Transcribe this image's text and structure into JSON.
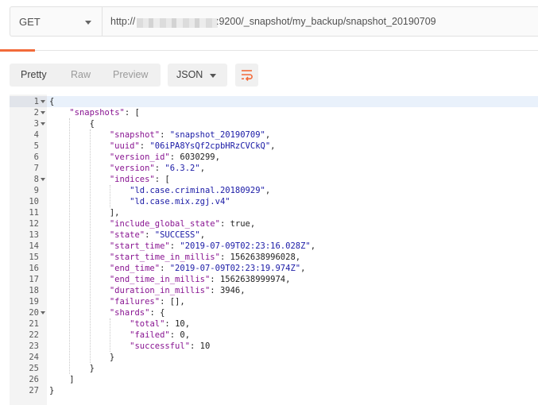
{
  "request": {
    "method": "GET",
    "url_prefix": "http://",
    "url_rest": ":9200/_snapshot/my_backup/snapshot_20190709"
  },
  "response_toolbar": {
    "view_modes": [
      "Pretty",
      "Raw",
      "Preview"
    ],
    "active_view": "Pretty",
    "format": "JSON",
    "wrap_icon": "wrap-lines-icon"
  },
  "colors": {
    "accent": "#f26b3a",
    "json_key": "#881391",
    "json_string": "#1a1aa6",
    "active_line": "#e9f1fb"
  },
  "code_lines": [
    {
      "n": "1",
      "fold": true,
      "active": true,
      "t": [
        [
          "p",
          "{"
        ]
      ]
    },
    {
      "n": "2",
      "fold": true,
      "t": [
        [
          "p",
          "    "
        ],
        [
          "k",
          "\"snapshots\""
        ],
        [
          "p",
          ": ["
        ]
      ]
    },
    {
      "n": "3",
      "fold": true,
      "t": [
        [
          "p",
          "        {"
        ]
      ]
    },
    {
      "n": "4",
      "t": [
        [
          "p",
          "            "
        ],
        [
          "k",
          "\"snapshot\""
        ],
        [
          "p",
          ": "
        ],
        [
          "s",
          "\"snapshot_20190709\""
        ],
        [
          "p",
          ","
        ]
      ]
    },
    {
      "n": "5",
      "t": [
        [
          "p",
          "            "
        ],
        [
          "k",
          "\"uuid\""
        ],
        [
          "p",
          ": "
        ],
        [
          "s",
          "\"06iPA8YsQf2cpbHRzCVCkQ\""
        ],
        [
          "p",
          ","
        ]
      ]
    },
    {
      "n": "6",
      "t": [
        [
          "p",
          "            "
        ],
        [
          "k",
          "\"version_id\""
        ],
        [
          "p",
          ": "
        ],
        [
          "n",
          "6030299"
        ],
        [
          "p",
          ","
        ]
      ]
    },
    {
      "n": "7",
      "t": [
        [
          "p",
          "            "
        ],
        [
          "k",
          "\"version\""
        ],
        [
          "p",
          ": "
        ],
        [
          "s",
          "\"6.3.2\""
        ],
        [
          "p",
          ","
        ]
      ]
    },
    {
      "n": "8",
      "fold": true,
      "t": [
        [
          "p",
          "            "
        ],
        [
          "k",
          "\"indices\""
        ],
        [
          "p",
          ": ["
        ]
      ]
    },
    {
      "n": "9",
      "t": [
        [
          "p",
          "                "
        ],
        [
          "s",
          "\"ld.case.criminal.20180929\""
        ],
        [
          "p",
          ","
        ]
      ]
    },
    {
      "n": "10",
      "t": [
        [
          "p",
          "                "
        ],
        [
          "s",
          "\"ld.case.mix.zgj.v4\""
        ]
      ]
    },
    {
      "n": "11",
      "t": [
        [
          "p",
          "            ],"
        ]
      ]
    },
    {
      "n": "12",
      "t": [
        [
          "p",
          "            "
        ],
        [
          "k",
          "\"include_global_state\""
        ],
        [
          "p",
          ": "
        ],
        [
          "n",
          "true"
        ],
        [
          "p",
          ","
        ]
      ]
    },
    {
      "n": "13",
      "t": [
        [
          "p",
          "            "
        ],
        [
          "k",
          "\"state\""
        ],
        [
          "p",
          ": "
        ],
        [
          "s",
          "\"SUCCESS\""
        ],
        [
          "p",
          ","
        ]
      ]
    },
    {
      "n": "14",
      "t": [
        [
          "p",
          "            "
        ],
        [
          "k",
          "\"start_time\""
        ],
        [
          "p",
          ": "
        ],
        [
          "s",
          "\"2019-07-09T02:23:16.028Z\""
        ],
        [
          "p",
          ","
        ]
      ]
    },
    {
      "n": "15",
      "t": [
        [
          "p",
          "            "
        ],
        [
          "k",
          "\"start_time_in_millis\""
        ],
        [
          "p",
          ": "
        ],
        [
          "n",
          "1562638996028"
        ],
        [
          "p",
          ","
        ]
      ]
    },
    {
      "n": "16",
      "t": [
        [
          "p",
          "            "
        ],
        [
          "k",
          "\"end_time\""
        ],
        [
          "p",
          ": "
        ],
        [
          "s",
          "\"2019-07-09T02:23:19.974Z\""
        ],
        [
          "p",
          ","
        ]
      ]
    },
    {
      "n": "17",
      "t": [
        [
          "p",
          "            "
        ],
        [
          "k",
          "\"end_time_in_millis\""
        ],
        [
          "p",
          ": "
        ],
        [
          "n",
          "1562638999974"
        ],
        [
          "p",
          ","
        ]
      ]
    },
    {
      "n": "18",
      "t": [
        [
          "p",
          "            "
        ],
        [
          "k",
          "\"duration_in_millis\""
        ],
        [
          "p",
          ": "
        ],
        [
          "n",
          "3946"
        ],
        [
          "p",
          ","
        ]
      ]
    },
    {
      "n": "19",
      "t": [
        [
          "p",
          "            "
        ],
        [
          "k",
          "\"failures\""
        ],
        [
          "p",
          ": [],"
        ]
      ]
    },
    {
      "n": "20",
      "fold": true,
      "t": [
        [
          "p",
          "            "
        ],
        [
          "k",
          "\"shards\""
        ],
        [
          "p",
          ": {"
        ]
      ]
    },
    {
      "n": "21",
      "t": [
        [
          "p",
          "                "
        ],
        [
          "k",
          "\"total\""
        ],
        [
          "p",
          ": "
        ],
        [
          "n",
          "10"
        ],
        [
          "p",
          ","
        ]
      ]
    },
    {
      "n": "22",
      "t": [
        [
          "p",
          "                "
        ],
        [
          "k",
          "\"failed\""
        ],
        [
          "p",
          ": "
        ],
        [
          "n",
          "0"
        ],
        [
          "p",
          ","
        ]
      ]
    },
    {
      "n": "23",
      "t": [
        [
          "p",
          "                "
        ],
        [
          "k",
          "\"successful\""
        ],
        [
          "p",
          ": "
        ],
        [
          "n",
          "10"
        ]
      ]
    },
    {
      "n": "24",
      "t": [
        [
          "p",
          "            }"
        ]
      ]
    },
    {
      "n": "25",
      "t": [
        [
          "p",
          "        }"
        ]
      ]
    },
    {
      "n": "26",
      "t": [
        [
          "p",
          "    ]"
        ]
      ]
    },
    {
      "n": "27",
      "t": [
        [
          "p",
          "}"
        ]
      ]
    }
  ]
}
